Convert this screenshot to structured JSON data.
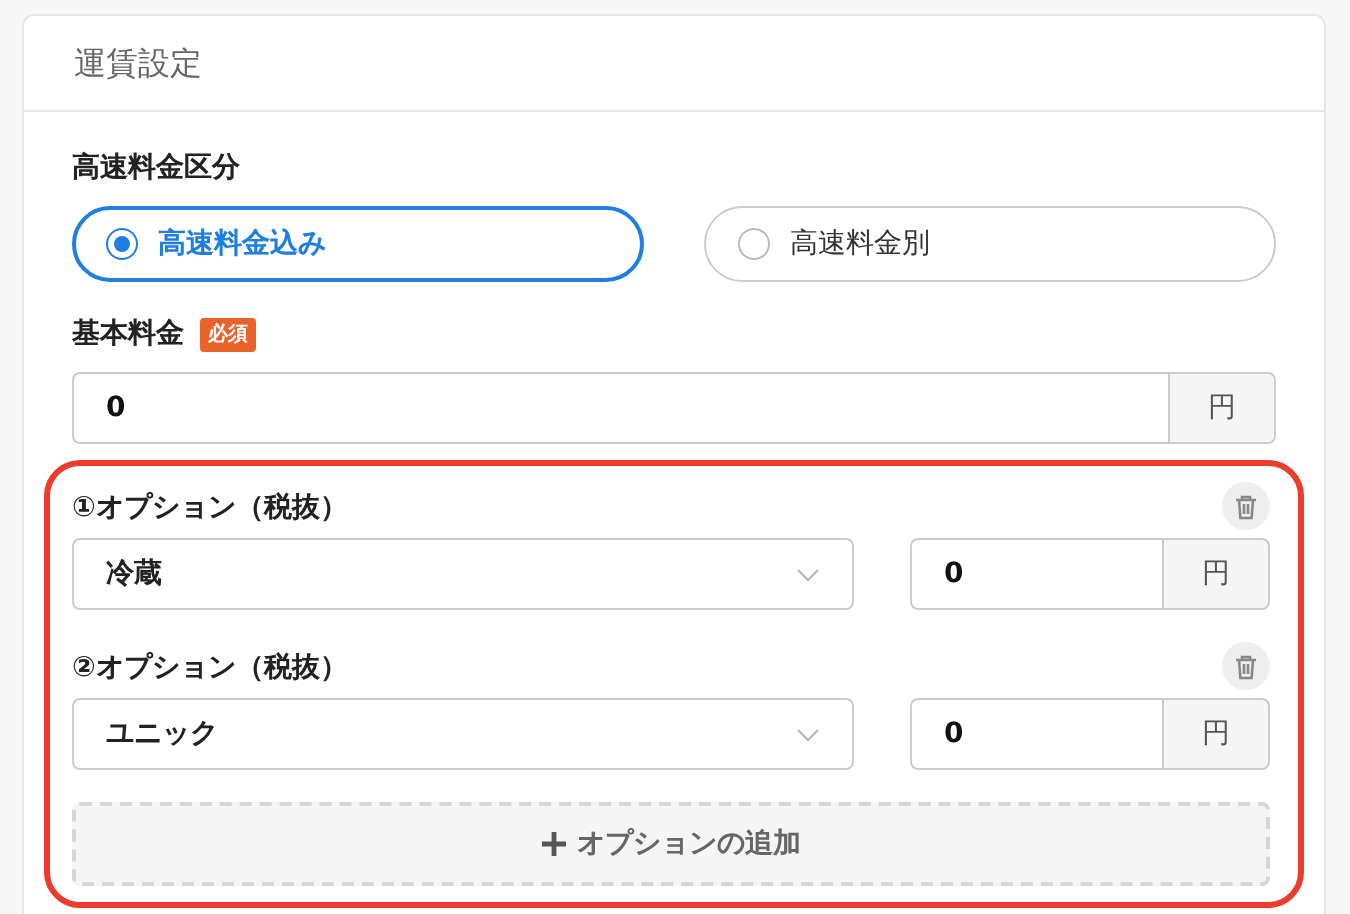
{
  "card": {
    "title": "運賃設定"
  },
  "highway_fee": {
    "label": "高速料金区分",
    "options": [
      {
        "label": "高速料金込み",
        "selected": true
      },
      {
        "label": "高速料金別",
        "selected": false
      }
    ]
  },
  "base_fee": {
    "label": "基本料金",
    "required_badge": "必須",
    "value": "0",
    "unit": "円"
  },
  "option_section": {
    "highlighted": true,
    "items": [
      {
        "label": "①オプション（税抜）",
        "value": "冷蔵",
        "amount": "0",
        "unit": "円"
      },
      {
        "label": "②オプション（税抜）",
        "value": "ユニック",
        "amount": "0",
        "unit": "円"
      }
    ],
    "add_button": "オプションの追加"
  }
}
